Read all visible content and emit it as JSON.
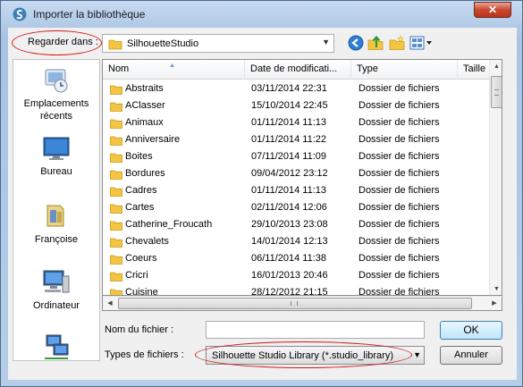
{
  "window": {
    "title": "Importer la bibliothèque",
    "close_glyph": "✕"
  },
  "lookin": {
    "label": "Regarder dans :",
    "value": "SilhouetteStudio",
    "arrow": "▼"
  },
  "toolbar": {
    "icons": [
      "back-icon",
      "up-folder-icon",
      "new-folder-icon",
      "view-menu-icon"
    ]
  },
  "places": [
    {
      "label": "Emplacements récents",
      "icon": "recent-places-icon"
    },
    {
      "label": "Bureau",
      "icon": "desktop-icon"
    },
    {
      "label": "Françoise",
      "icon": "user-folder-icon"
    },
    {
      "label": "Ordinateur",
      "icon": "computer-icon"
    },
    {
      "label": "",
      "icon": "network-icon"
    }
  ],
  "columns": [
    "Nom",
    "Date de modificati...",
    "Type",
    "Taille"
  ],
  "files": [
    {
      "name": "Abstraits",
      "date": "03/11/2014 22:31",
      "type": "Dossier de fichiers"
    },
    {
      "name": "AClasser",
      "date": "15/10/2014 22:45",
      "type": "Dossier de fichiers"
    },
    {
      "name": "Animaux",
      "date": "01/11/2014 11:13",
      "type": "Dossier de fichiers"
    },
    {
      "name": "Anniversaire",
      "date": "01/11/2014 11:22",
      "type": "Dossier de fichiers"
    },
    {
      "name": "Boites",
      "date": "07/11/2014 11:09",
      "type": "Dossier de fichiers"
    },
    {
      "name": "Bordures",
      "date": "09/04/2012 23:12",
      "type": "Dossier de fichiers"
    },
    {
      "name": "Cadres",
      "date": "01/11/2014 11:13",
      "type": "Dossier de fichiers"
    },
    {
      "name": "Cartes",
      "date": "02/11/2014 12:06",
      "type": "Dossier de fichiers"
    },
    {
      "name": "Catherine_Froucath",
      "date": "29/10/2013 23:08",
      "type": "Dossier de fichiers"
    },
    {
      "name": "Chevalets",
      "date": "14/01/2014 12:13",
      "type": "Dossier de fichiers"
    },
    {
      "name": "Coeurs",
      "date": "06/11/2014 11:38",
      "type": "Dossier de fichiers"
    },
    {
      "name": "Cricri",
      "date": "16/01/2013 20:46",
      "type": "Dossier de fichiers"
    },
    {
      "name": "Cuisine",
      "date": "28/12/2012 21:15",
      "type": "Dossier de fichiers"
    }
  ],
  "filename": {
    "label": "Nom du fichier :",
    "value": ""
  },
  "filetype": {
    "label": "Types de fichiers :",
    "value": "Silhouette Studio Library (*.studio_library)",
    "arrow": "▼"
  },
  "buttons": {
    "ok": "OK",
    "cancel": "Annuler"
  },
  "colors": {
    "annotation_red": "#d01818",
    "folder_yellow": "#f5c542",
    "title_bar": "#b6cde8"
  }
}
